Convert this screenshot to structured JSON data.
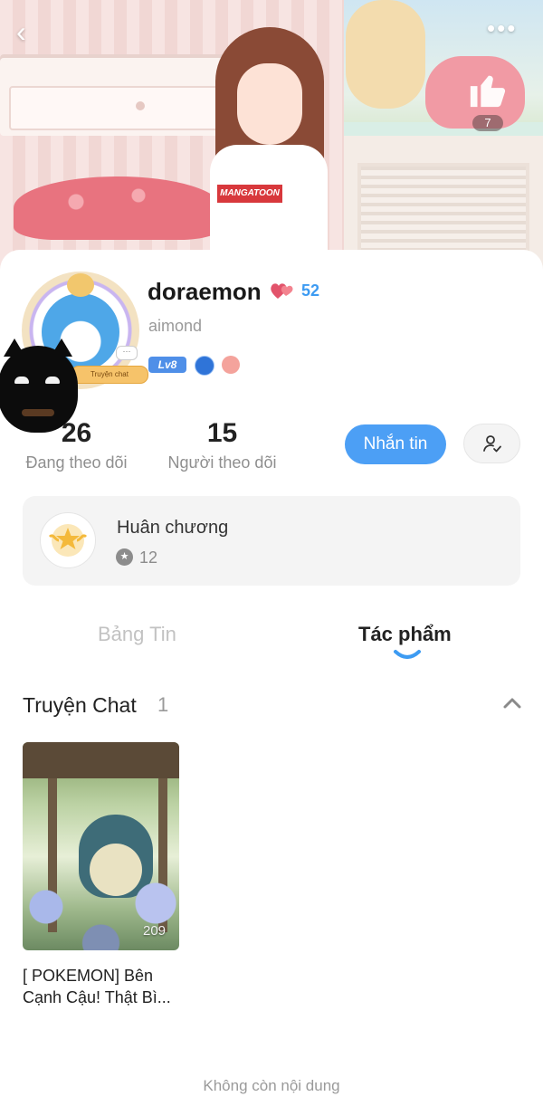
{
  "profile": {
    "username": "doraemon",
    "heart_count": "52",
    "handle": "aimond",
    "level": "Lv8",
    "avatar_tag": "Truyện chat",
    "like_count": "7"
  },
  "banner": {
    "shirt_text": "MANGATOON"
  },
  "stats": {
    "following_count": "26",
    "following_label": "Đang theo dõi",
    "followers_count": "15",
    "followers_label": "Người theo dõi"
  },
  "actions": {
    "message_label": "Nhắn tin"
  },
  "medals": {
    "title": "Huân chương",
    "count": "12"
  },
  "tabs": [
    {
      "label": "Bảng Tin",
      "active": false
    },
    {
      "label": "Tác phẩm",
      "active": true
    }
  ],
  "section": {
    "title": "Truyện Chat",
    "count": "1"
  },
  "works": [
    {
      "title": "[ POKEMON] Bên Cạnh Cậu! Thật Bì...",
      "count": "209"
    }
  ],
  "footer": {
    "end_text": "Không còn nội dung"
  },
  "colors": {
    "accent": "#4c9ff5",
    "heart_count": "#3d9bf2"
  },
  "icons": [
    "back-arrow-icon",
    "more-dots-icon",
    "thumbs-up-icon",
    "hearts-icon",
    "level-badge-icon",
    "follow-status-icon",
    "medal-icon",
    "collapse-chevron-icon"
  ]
}
